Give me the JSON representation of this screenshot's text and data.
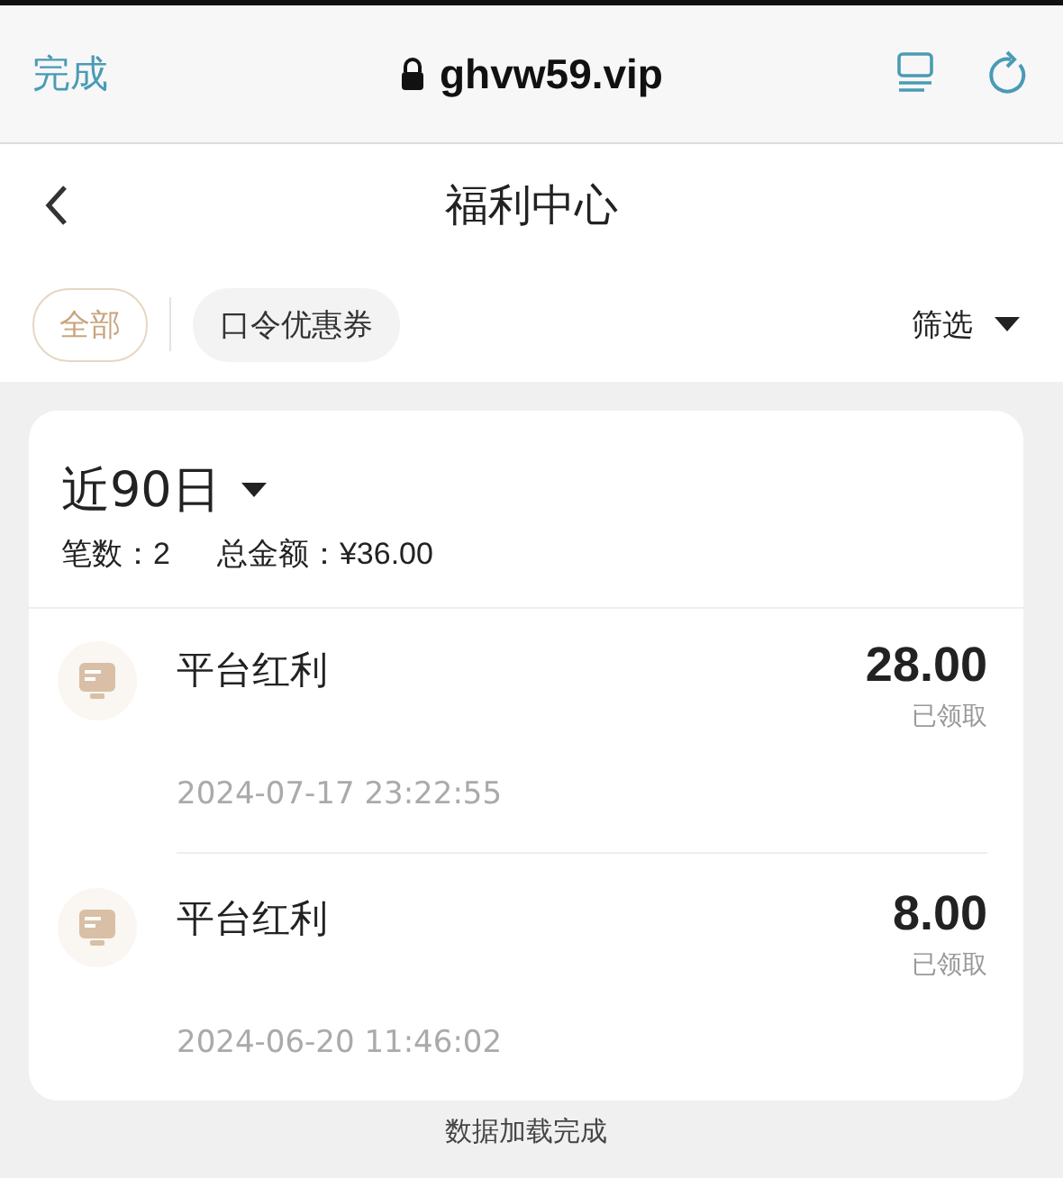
{
  "browser": {
    "done": "完成",
    "url": "ghvw59.vip"
  },
  "nav": {
    "title": "福利中心"
  },
  "tabs": [
    {
      "label": "全部",
      "selected": true
    },
    {
      "label": "口令优惠券",
      "selected": false
    }
  ],
  "filter": "筛选",
  "summary": {
    "period": "近90日",
    "count_label": "笔数：",
    "count": "2",
    "total_label": "总金额：",
    "total": "¥36.00"
  },
  "records": [
    {
      "name": "平台红利",
      "amount": "28.00",
      "status": "已领取",
      "time": "2024-07-17 23:22:55"
    },
    {
      "name": "平台红利",
      "amount": "8.00",
      "status": "已领取",
      "time": "2024-06-20 11:46:02"
    }
  ],
  "footer": "数据加载完成"
}
